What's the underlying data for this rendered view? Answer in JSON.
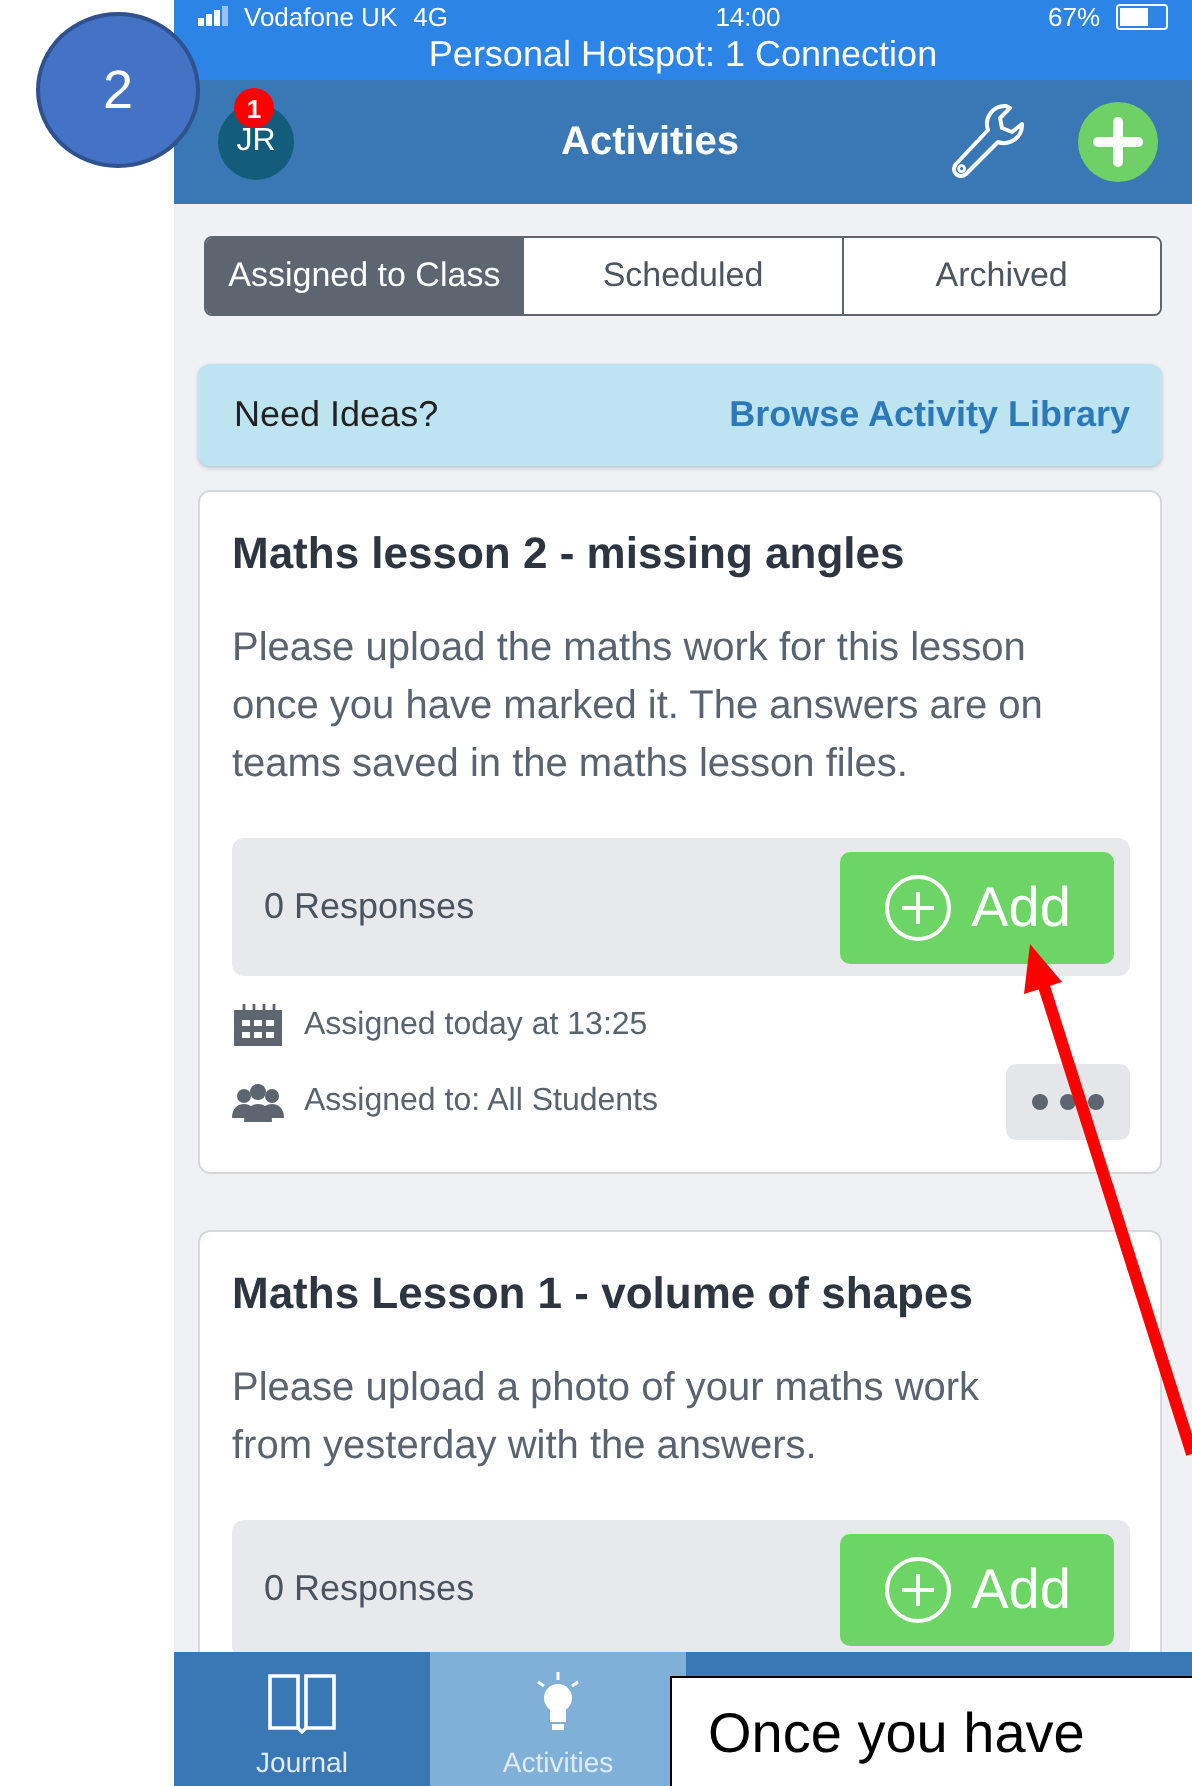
{
  "annotation": {
    "step": "2",
    "callout": "Once you have"
  },
  "status_bar": {
    "carrier": "Vodafone UK",
    "network": "4G",
    "time": "14:00",
    "battery": "67%",
    "hotspot": "Personal Hotspot: 1 Connection"
  },
  "header": {
    "avatar": "JR",
    "badge": "1",
    "title": "Activities"
  },
  "segments": [
    {
      "label": "Assigned to Class",
      "selected": true
    },
    {
      "label": "Scheduled",
      "selected": false
    },
    {
      "label": "Archived",
      "selected": false
    }
  ],
  "ideas_banner": {
    "label": "Need Ideas?",
    "link": "Browse Activity Library"
  },
  "activities": [
    {
      "title": "Maths lesson 2 - missing angles",
      "description": "Please upload the maths work for this lesson once you have marked it. The answers are on teams saved in the maths lesson files.",
      "responses": "0 Responses",
      "add": "Add",
      "assigned": "Assigned today at 13:25",
      "assigned_to": "Assigned to: All Students"
    },
    {
      "title": "Maths Lesson 1 - volume of shapes",
      "description": "Please upload a photo of your maths work from yesterday with the answers.",
      "responses": "0 Responses",
      "add": "Add"
    }
  ],
  "tabs": [
    {
      "label": "Journal",
      "selected": false,
      "kind": "book"
    },
    {
      "label": "Activities",
      "selected": true,
      "kind": "bulb"
    }
  ]
}
